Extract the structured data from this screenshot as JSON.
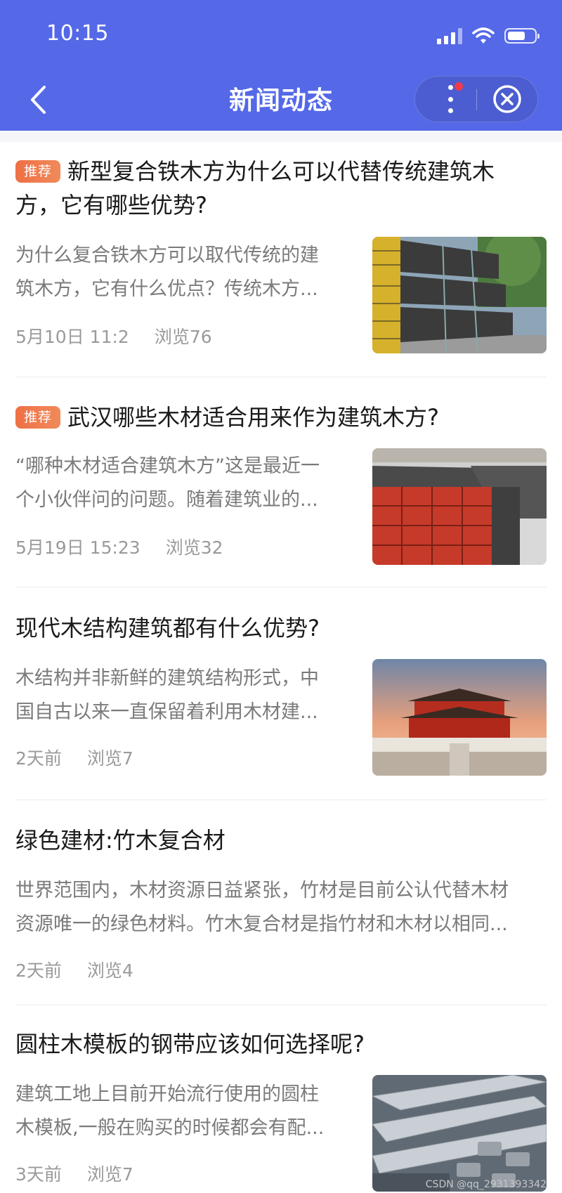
{
  "status_bar": {
    "time": "10:15"
  },
  "nav": {
    "title": "新闻动态"
  },
  "articles": [
    {
      "badge": "推荐",
      "title": "新型复合铁木方为什么可以代替传统建筑木方，它有哪些优势?",
      "summary_line1": "为什么复合铁木方可以取代传统的建",
      "summary_line2": "筑木方，它有什么优点？传统木方...",
      "date": "5月10日 11:2",
      "views": "浏览76"
    },
    {
      "badge": "推荐",
      "title": "武汉哪些木材适合用来作为建筑木方?",
      "summary_line1": "“哪种木材适合建筑木方”这是最近一",
      "summary_line2": "个小伙伴问的问题。随着建筑业的...",
      "date": "5月19日 15:23",
      "views": "浏览32"
    },
    {
      "title": "现代木结构建筑都有什么优势?",
      "summary_line1": "木结构并非新鲜的建筑结构形式，中",
      "summary_line2": "国自古以来一直保留着利用木材建...",
      "date": "2天前",
      "views": "浏览7"
    },
    {
      "title": "绿色建材:竹木复合材",
      "summary_line1": "世界范围内，木材资源日益紧张，竹材是目前公认代替木材",
      "summary_line2": "资源唯一的绿色材料。竹木复合材是指竹材和木材以相同...",
      "date": "2天前",
      "views": "浏览4"
    },
    {
      "title": "圆柱木模板的钢带应该如何选择呢?",
      "summary_line1": "建筑工地上目前开始流行使用的圆柱",
      "summary_line2": "木模板,一般在购买的时候都会有配...",
      "date": "3天前",
      "views": "浏览7"
    }
  ],
  "watermark": "CSDN @qq_2931393342",
  "colors": {
    "header_bg": "#5468e8",
    "badge": "#ef6f45",
    "notify_dot": "#f03c4a"
  }
}
